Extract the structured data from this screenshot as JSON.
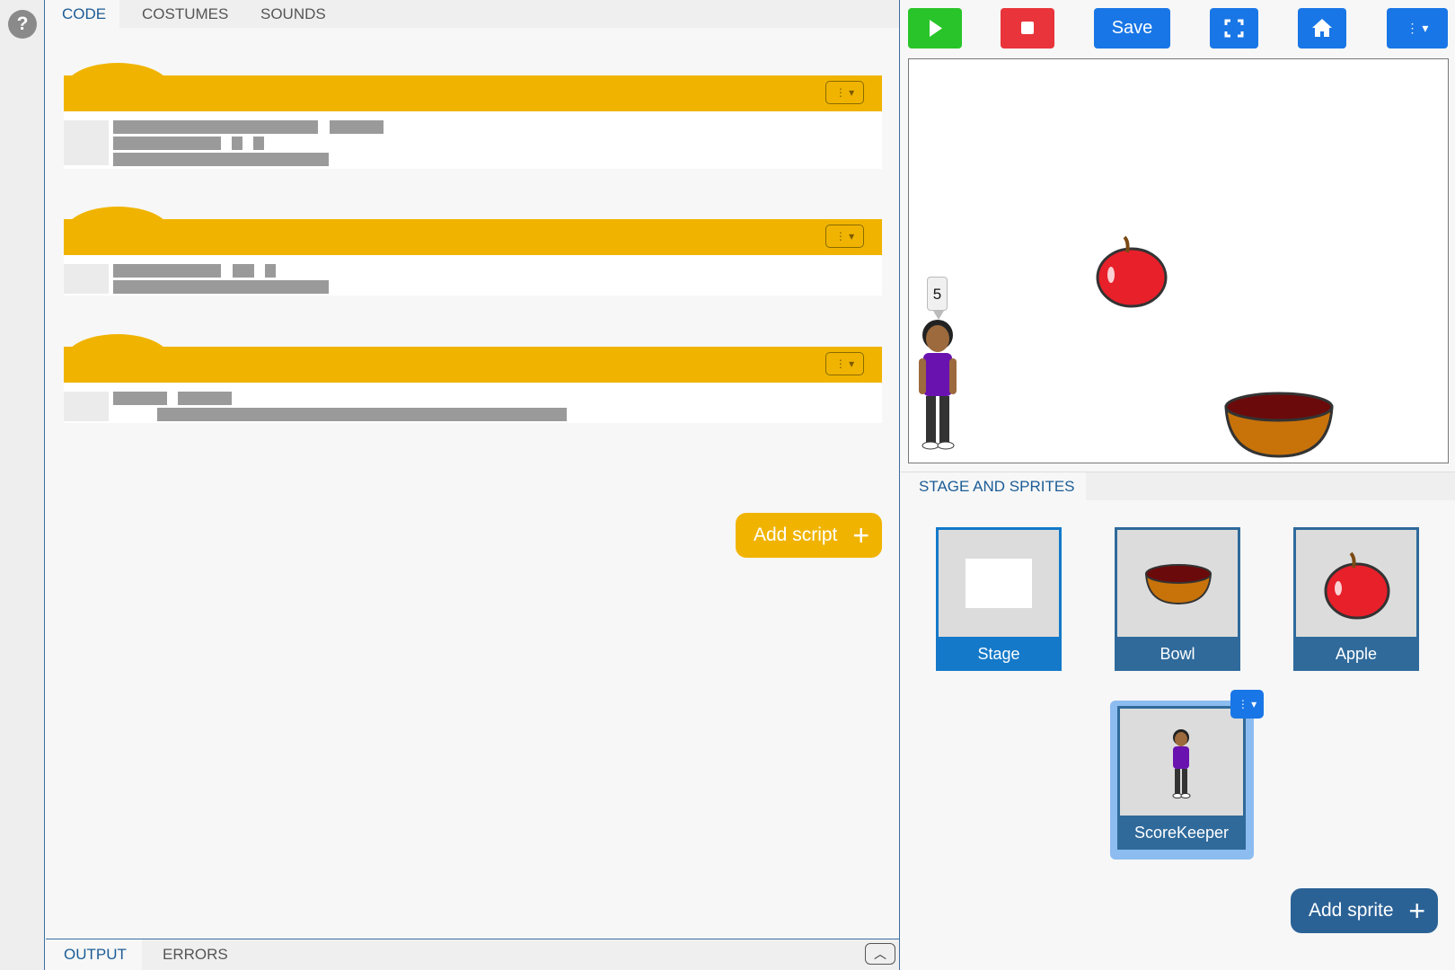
{
  "help": {
    "icon": "?"
  },
  "code_tabs": [
    {
      "label": "CODE",
      "active": true
    },
    {
      "label": "COSTUMES",
      "active": false
    },
    {
      "label": "SOUNDS",
      "active": false
    }
  ],
  "scripts": {
    "menu_glyph": "⋮ ▾",
    "count": 3
  },
  "add_script": {
    "label": "Add script",
    "icon": "+"
  },
  "bottom_tabs": [
    {
      "label": "OUTPUT",
      "active": true
    },
    {
      "label": "ERRORS",
      "active": false
    }
  ],
  "collapse_glyph": "︿",
  "toolbar": {
    "run_icon": "play-icon",
    "stop_icon": "stop-icon",
    "save_label": "Save",
    "fullscreen_icon": "fullscreen-icon",
    "home_icon": "home-icon",
    "more_glyph": "⋮ ▾"
  },
  "stage": {
    "speech_bubble": "5"
  },
  "sprites_panel": {
    "tab_label": "STAGE AND SPRITES"
  },
  "sprites": [
    {
      "label": "Stage",
      "thumb": "white-backdrop"
    },
    {
      "label": "Bowl",
      "thumb": "bowl"
    },
    {
      "label": "Apple",
      "thumb": "apple"
    },
    {
      "label": "ScoreKeeper",
      "thumb": "person",
      "selected": true
    }
  ],
  "sprite_menu_glyph": "⋮ ▾",
  "add_sprite": {
    "label": "Add sprite",
    "icon": "+"
  },
  "colors": {
    "hat_yellow": "#f0b400",
    "sprite_blue": "#2f6a9b",
    "stage_card_blue": "#1479c9",
    "toolbar_blue": "#1976e6",
    "run_green": "#29c429",
    "stop_red": "#e8343a"
  }
}
